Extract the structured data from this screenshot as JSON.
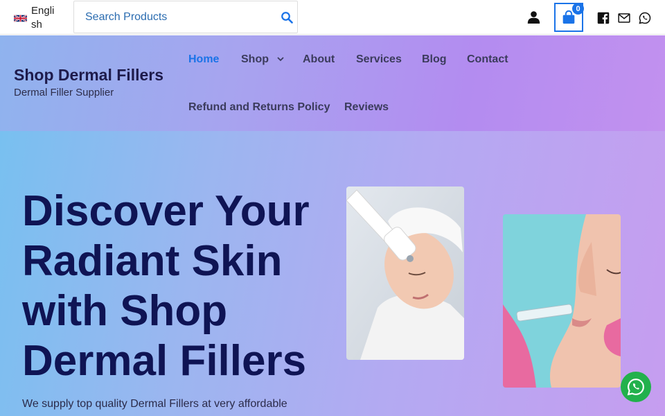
{
  "topbar": {
    "language_label": "English",
    "search_placeholder": "Search Products",
    "cart_count": "0"
  },
  "header": {
    "site_title": "Shop Dermal Fillers",
    "tagline": "Dermal Filler Supplier",
    "nav": [
      {
        "label": "Home",
        "active": true
      },
      {
        "label": "Shop",
        "has_dropdown": true
      },
      {
        "label": "About"
      },
      {
        "label": "Services"
      },
      {
        "label": "Blog"
      },
      {
        "label": "Contact"
      },
      {
        "label": "Refund and Returns Policy"
      },
      {
        "label": "Reviews"
      }
    ]
  },
  "hero": {
    "title": "Discover Your Radiant Skin with Shop Dermal Fillers",
    "text": "We supply top quality Dermal Fillers at very affordable"
  },
  "icons": {
    "search": "search-icon",
    "user": "user-icon",
    "cart": "shopping-bag-icon",
    "facebook": "facebook-icon",
    "email": "envelope-icon",
    "whatsapp": "whatsapp-icon"
  },
  "colors": {
    "accent": "#1a73e8",
    "heading": "#0f1454",
    "whatsapp_green": "#22b14c"
  }
}
